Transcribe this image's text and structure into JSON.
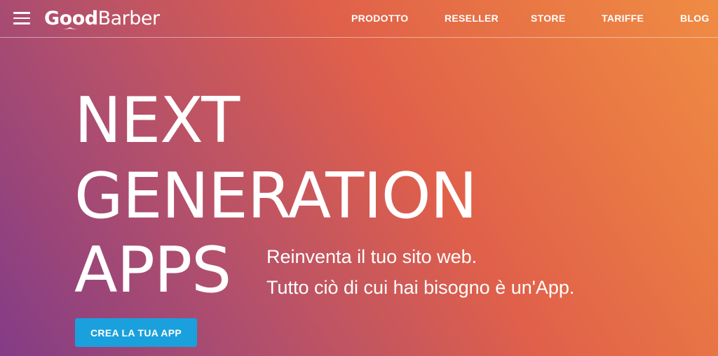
{
  "header": {
    "logo": {
      "part1": "Good",
      "part2": "Barber"
    },
    "menu_icon": "hamburger-menu-icon",
    "nav": [
      {
        "label": "PRODOTTO"
      },
      {
        "label": "RESELLER"
      },
      {
        "label": "STORE"
      },
      {
        "label": "TARIFFE"
      },
      {
        "label": "BLOG"
      }
    ]
  },
  "hero": {
    "title_lines": [
      "NEXT",
      "GENERATION",
      "APPS"
    ],
    "tagline_lines": [
      "Reinventa il tuo sito web.",
      "Tutto ciò di cui hai bisogno è un'App."
    ],
    "cta_label": "CREA LA TUA APP"
  },
  "colors": {
    "gradient_start": "#833c86",
    "gradient_mid": "#e0604a",
    "gradient_end": "#ef8c43",
    "cta_background": "#1aa0dc",
    "text": "#ffffff"
  }
}
